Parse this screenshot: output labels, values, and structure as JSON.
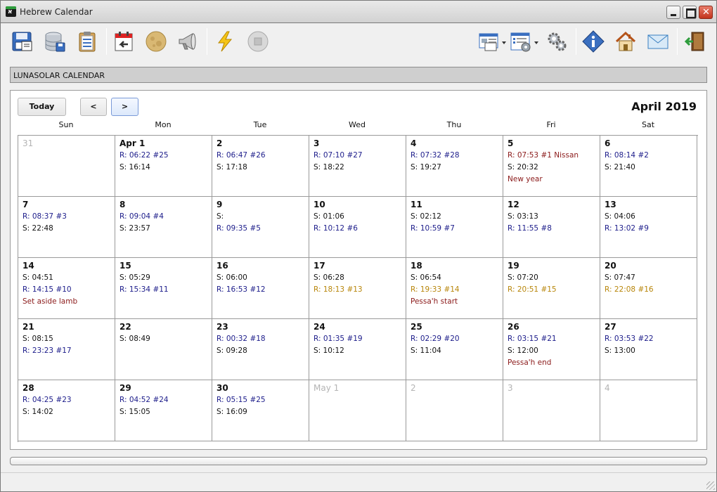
{
  "window": {
    "title": "Hebrew Calendar"
  },
  "toolbar": {
    "left": [
      "save-data-icon",
      "database-save-icon",
      "clipboard-icon",
      "calendar-import-icon",
      "moon-icon",
      "megaphone-icon",
      "lightning-icon",
      "stop-icon"
    ],
    "right": [
      "view-options-icon",
      "settings-list-icon",
      "gears-icon",
      "info-icon",
      "home-icon",
      "mail-icon",
      "exit-door-icon"
    ]
  },
  "section": {
    "title": "LUNASOLAR CALENDAR"
  },
  "calendar": {
    "today_label": "Today",
    "prev_label": "<",
    "next_label": ">",
    "month_title": "April 2019",
    "weekdays": [
      "Sun",
      "Mon",
      "Tue",
      "Wed",
      "Thu",
      "Fri",
      "Sat"
    ],
    "weeks": [
      [
        {
          "day": "31",
          "other": true,
          "lines": []
        },
        {
          "day": "Apr 1",
          "lines": [
            {
              "t": "R: 06:22 #25",
              "k": "rise"
            },
            {
              "t": "S: 16:14",
              "k": "set"
            }
          ]
        },
        {
          "day": "2",
          "lines": [
            {
              "t": "R: 06:47 #26",
              "k": "rise"
            },
            {
              "t": "S: 17:18",
              "k": "set"
            }
          ]
        },
        {
          "day": "3",
          "lines": [
            {
              "t": "R: 07:10 #27",
              "k": "rise"
            },
            {
              "t": "S: 18:22",
              "k": "set"
            }
          ]
        },
        {
          "day": "4",
          "lines": [
            {
              "t": "R: 07:32 #28",
              "k": "rise"
            },
            {
              "t": "S: 19:27",
              "k": "set"
            }
          ]
        },
        {
          "day": "5",
          "lines": [
            {
              "t": "R: 07:53 #1 Nissan",
              "k": "red"
            },
            {
              "t": "S: 20:32",
              "k": "set"
            },
            {
              "t": "New year",
              "k": "red"
            }
          ]
        },
        {
          "day": "6",
          "lines": [
            {
              "t": "R: 08:14 #2",
              "k": "rise"
            },
            {
              "t": "S: 21:40",
              "k": "set"
            }
          ]
        }
      ],
      [
        {
          "day": "7",
          "lines": [
            {
              "t": "R: 08:37 #3",
              "k": "rise"
            },
            {
              "t": "S: 22:48",
              "k": "set"
            }
          ]
        },
        {
          "day": "8",
          "lines": [
            {
              "t": "R: 09:04 #4",
              "k": "rise"
            },
            {
              "t": "S: 23:57",
              "k": "set"
            }
          ]
        },
        {
          "day": "9",
          "lines": [
            {
              "t": "S:",
              "k": "set"
            },
            {
              "t": "R: 09:35 #5",
              "k": "rise"
            }
          ]
        },
        {
          "day": "10",
          "lines": [
            {
              "t": "S: 01:06",
              "k": "set"
            },
            {
              "t": "R: 10:12 #6",
              "k": "rise"
            }
          ]
        },
        {
          "day": "11",
          "lines": [
            {
              "t": "S: 02:12",
              "k": "set"
            },
            {
              "t": "R: 10:59 #7",
              "k": "rise"
            }
          ]
        },
        {
          "day": "12",
          "lines": [
            {
              "t": "S: 03:13",
              "k": "set"
            },
            {
              "t": "R: 11:55 #8",
              "k": "rise"
            }
          ]
        },
        {
          "day": "13",
          "lines": [
            {
              "t": "S: 04:06",
              "k": "set"
            },
            {
              "t": "R: 13:02 #9",
              "k": "rise"
            }
          ]
        }
      ],
      [
        {
          "day": "14",
          "lines": [
            {
              "t": "S: 04:51",
              "k": "set"
            },
            {
              "t": "R: 14:15 #10",
              "k": "rise"
            },
            {
              "t": "Set aside lamb",
              "k": "red"
            }
          ]
        },
        {
          "day": "15",
          "lines": [
            {
              "t": "S: 05:29",
              "k": "set"
            },
            {
              "t": "R: 15:34 #11",
              "k": "rise"
            }
          ]
        },
        {
          "day": "16",
          "lines": [
            {
              "t": "S: 06:00",
              "k": "set"
            },
            {
              "t": "R: 16:53 #12",
              "k": "rise"
            }
          ]
        },
        {
          "day": "17",
          "lines": [
            {
              "t": "S: 06:28",
              "k": "set"
            },
            {
              "t": "R: 18:13 #13",
              "k": "gold"
            }
          ]
        },
        {
          "day": "18",
          "lines": [
            {
              "t": "S: 06:54",
              "k": "set"
            },
            {
              "t": "R: 19:33 #14",
              "k": "gold"
            },
            {
              "t": "Pessa'h start",
              "k": "red"
            }
          ]
        },
        {
          "day": "19",
          "lines": [
            {
              "t": "S: 07:20",
              "k": "set"
            },
            {
              "t": "R: 20:51 #15",
              "k": "gold"
            }
          ]
        },
        {
          "day": "20",
          "lines": [
            {
              "t": "S: 07:47",
              "k": "set"
            },
            {
              "t": "R: 22:08 #16",
              "k": "gold"
            }
          ]
        }
      ],
      [
        {
          "day": "21",
          "lines": [
            {
              "t": "S: 08:15",
              "k": "set"
            },
            {
              "t": "R: 23:23 #17",
              "k": "rise"
            }
          ]
        },
        {
          "day": "22",
          "lines": [
            {
              "t": "S: 08:49",
              "k": "set"
            }
          ]
        },
        {
          "day": "23",
          "lines": [
            {
              "t": "R: 00:32 #18",
              "k": "rise"
            },
            {
              "t": "S: 09:28",
              "k": "set"
            }
          ]
        },
        {
          "day": "24",
          "lines": [
            {
              "t": "R: 01:35 #19",
              "k": "rise"
            },
            {
              "t": "S: 10:12",
              "k": "set"
            }
          ]
        },
        {
          "day": "25",
          "lines": [
            {
              "t": "R: 02:29 #20",
              "k": "rise"
            },
            {
              "t": "S: 11:04",
              "k": "set"
            }
          ]
        },
        {
          "day": "26",
          "lines": [
            {
              "t": "R: 03:15 #21",
              "k": "rise"
            },
            {
              "t": "S: 12:00",
              "k": "set"
            },
            {
              "t": "Pessa'h end",
              "k": "red"
            }
          ]
        },
        {
          "day": "27",
          "lines": [
            {
              "t": "R: 03:53 #22",
              "k": "rise"
            },
            {
              "t": "S: 13:00",
              "k": "set"
            }
          ]
        }
      ],
      [
        {
          "day": "28",
          "lines": [
            {
              "t": "R: 04:25 #23",
              "k": "rise"
            },
            {
              "t": "S: 14:02",
              "k": "set"
            }
          ]
        },
        {
          "day": "29",
          "lines": [
            {
              "t": "R: 04:52 #24",
              "k": "rise"
            },
            {
              "t": "S: 15:05",
              "k": "set"
            }
          ]
        },
        {
          "day": "30",
          "lines": [
            {
              "t": "R: 05:15 #25",
              "k": "rise"
            },
            {
              "t": "S: 16:09",
              "k": "set"
            }
          ]
        },
        {
          "day": "May 1",
          "other": true,
          "lines": []
        },
        {
          "day": "2",
          "other": true,
          "lines": []
        },
        {
          "day": "3",
          "other": true,
          "lines": []
        },
        {
          "day": "4",
          "other": true,
          "lines": []
        }
      ]
    ]
  },
  "colors": {
    "rise": "#1c1c8a",
    "set": "#111111",
    "red": "#8b1a1a",
    "gold": "#b8860b",
    "other_day": "#b4b4b4"
  }
}
